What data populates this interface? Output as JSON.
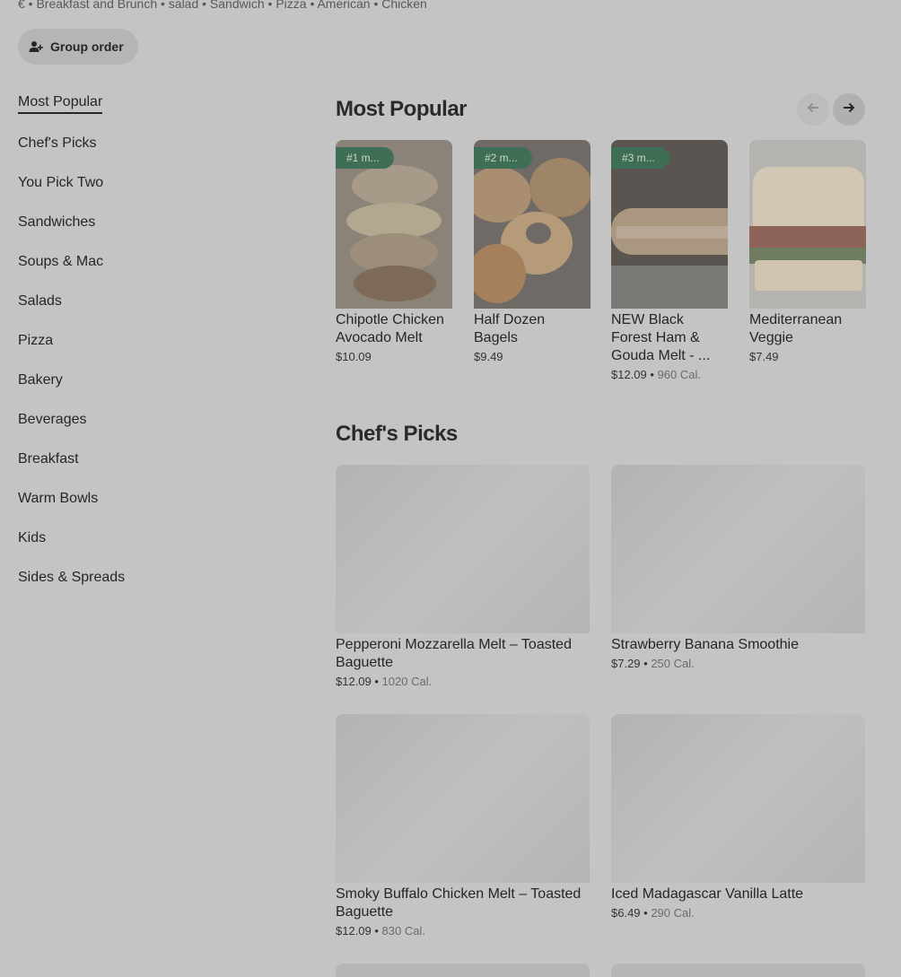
{
  "store": {
    "tags": "€ • Breakfast and Brunch • salad • Sandwich • Pizza • American • Chicken"
  },
  "group_order": {
    "label": "Group order",
    "icon": "add-person-icon"
  },
  "categories": [
    "Most Popular",
    "Chef's Picks",
    "You Pick Two",
    "Sandwiches",
    "Soups & Mac",
    "Salads",
    "Pizza",
    "Bakery",
    "Beverages",
    "Breakfast",
    "Warm Bowls",
    "Kids",
    "Sides & Spreads"
  ],
  "active_category": "Most Popular",
  "sections": {
    "most_popular": {
      "title": "Most Popular",
      "prev_icon": "arrow-left-icon",
      "next_icon": "arrow-right-icon",
      "items": [
        {
          "badge": "#1 m...",
          "name": "Chipotle Chicken Avocado Melt",
          "price": "$10.09",
          "cal": ""
        },
        {
          "badge": "#2 m...",
          "name": "Half Dozen Bagels",
          "price": "$9.49",
          "cal": ""
        },
        {
          "badge": "#3 m...",
          "name": "NEW Black Forest Ham & Gouda Melt - ...",
          "price": "$12.09",
          "cal": "960 Cal."
        },
        {
          "badge": "",
          "name": "Mediterranean Veggie",
          "price": "$7.49",
          "cal": ""
        }
      ]
    },
    "chefs_picks": {
      "title": "Chef's Picks",
      "items": [
        {
          "name": "Pepperoni Mozzarella Melt – Toasted Baguette",
          "price": "$12.09",
          "cal": "1020 Cal."
        },
        {
          "name": "Strawberry Banana Smoothie",
          "price": "$7.29",
          "cal": "250 Cal."
        },
        {
          "name": "Smoky Buffalo Chicken Melt – Toasted Baguette",
          "price": "$12.09",
          "cal": "830 Cal."
        },
        {
          "name": "Iced Madagascar Vanilla Latte",
          "price": "$6.49",
          "cal": "290 Cal."
        }
      ]
    }
  },
  "separator": " • ",
  "colors": {
    "background": "#c4c4c4",
    "badge": "#3f6e56",
    "text": "#262626"
  }
}
